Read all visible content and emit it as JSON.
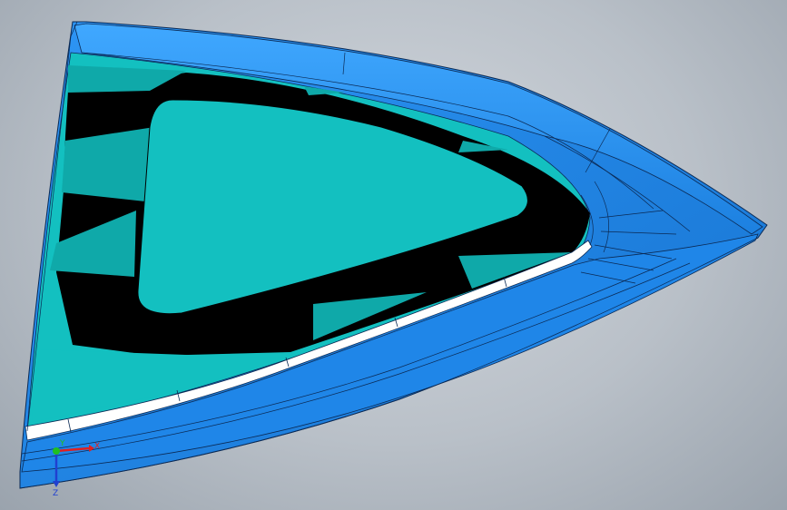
{
  "viewport": {
    "colors": {
      "background": "#c3c9d0",
      "body_blue": "#1f86e8",
      "body_blue_light": "#3aa0ff",
      "rim_blue": "#1378d6",
      "pocket_fill": "#13c0c0",
      "pocket_fill_dark": "#0fa9a9",
      "rib_black": "#000000",
      "gasket_white": "#ffffff",
      "edge_line": "#0b2a55"
    }
  },
  "triad": {
    "x_label": "X",
    "y_label": "Y",
    "z_label": "Z",
    "x_color": "#e02020",
    "y_color": "#20c020",
    "z_color": "#2040d0"
  }
}
